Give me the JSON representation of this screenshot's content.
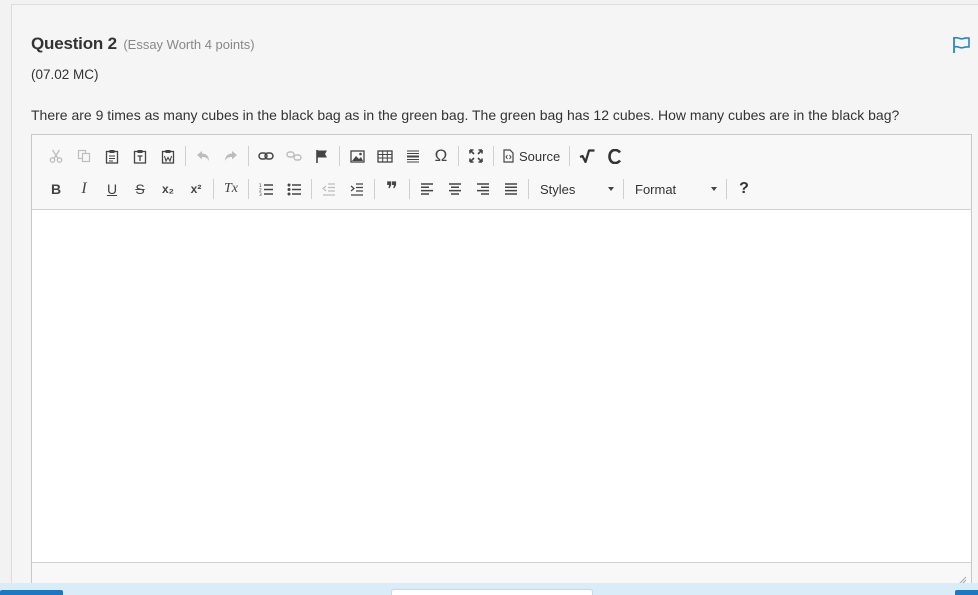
{
  "question": {
    "title": "Question 2",
    "meta": "(Essay Worth 4 points)",
    "code": "(07.02 MC)",
    "text": "There are 9 times as many cubes in the black bag as in the green bag. The green bag has 12 cubes. How many cubes are in the black bag?"
  },
  "toolbar": {
    "source_label": "Source",
    "styles_label": "Styles",
    "format_label": "Format",
    "help_label": "?",
    "bold_label": "B",
    "italic_label": "I",
    "underline_label": "U",
    "strike_label": "S",
    "omega_label": "Ω",
    "quote_label": "❞",
    "remove_format_label": "Tx",
    "subscript_label": "x₂",
    "superscript_label": "x²"
  },
  "colors": {
    "accent": "#1f77c1",
    "flag": "#2a86c8"
  },
  "icons": [
    "cut-icon",
    "copy-icon",
    "paste-icon",
    "paste-text-icon",
    "paste-word-icon",
    "undo-icon",
    "redo-icon",
    "link-icon",
    "unlink-icon",
    "anchor-flag-icon",
    "image-icon",
    "table-icon",
    "horizontal-rule-icon",
    "special-char-icon",
    "maximize-icon",
    "source-icon",
    "math-sqrt-icon",
    "chemistry-icon",
    "numbered-list-icon",
    "bulleted-list-icon",
    "outdent-icon",
    "indent-icon",
    "blockquote-icon",
    "align-left-icon",
    "align-center-icon",
    "align-right-icon",
    "justify-icon",
    "help-icon",
    "flag-icon",
    "resize-grip-icon"
  ]
}
